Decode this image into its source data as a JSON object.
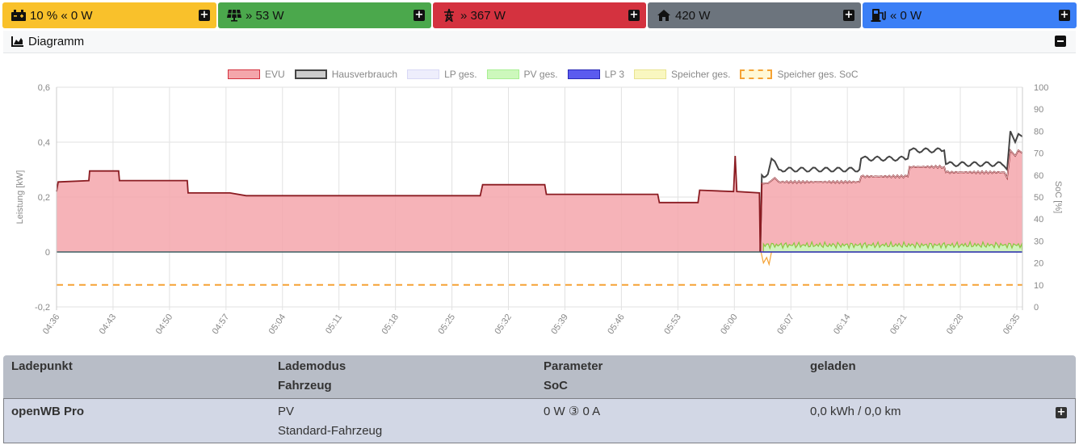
{
  "tiles": [
    {
      "label": "10 % « 0 W",
      "icon": "car-battery-icon",
      "color": "#f9c12b"
    },
    {
      "label": "» 53 W",
      "icon": "solar-panel-icon",
      "color": "#4ba84c"
    },
    {
      "label": "» 367 W",
      "icon": "power-pylon-icon",
      "color": "#d4323f"
    },
    {
      "label": "420 W",
      "icon": "home-icon",
      "color": "#6c747d"
    },
    {
      "label": "« 0 W",
      "icon": "ev-charger-icon",
      "color": "#3b7ff6"
    }
  ],
  "diagram": {
    "title": "Diagramm"
  },
  "chart_data": {
    "type": "area",
    "legend": [
      {
        "name": "EVU",
        "color": "#f4a6ab"
      },
      {
        "name": "Hausverbrauch",
        "color": "#444444"
      },
      {
        "name": "LP ges.",
        "color": "#e6e6fb"
      },
      {
        "name": "PV ges.",
        "color": "#c4f7b0"
      },
      {
        "name": "LP 3",
        "color": "#3a3ad6"
      },
      {
        "name": "Speicher ges.",
        "color": "#f8f6b8"
      },
      {
        "name": "Speicher ges. SoC",
        "color": "#f5a235"
      }
    ],
    "ylabel_left": "Leistung [kW]",
    "ylabel_right": "SoC [%]",
    "ylim": [
      -0.2,
      0.6
    ],
    "y2lim": [
      0,
      100
    ],
    "yticks_left": [
      "0,6",
      "0,4",
      "0,2",
      "0",
      "-0,2"
    ],
    "yticks_left_values": [
      0.6,
      0.4,
      0.2,
      0,
      -0.2
    ],
    "yticks_right": [
      "100",
      "90",
      "80",
      "70",
      "60",
      "50",
      "40",
      "30",
      "20",
      "10",
      "0"
    ],
    "xticks": [
      "04:36",
      "04:43",
      "04:50",
      "04:57",
      "05:04",
      "05:11",
      "05:18",
      "05:25",
      "05:32",
      "05:39",
      "05:46",
      "05:53",
      "06:00",
      "06:07",
      "06:14",
      "06:21",
      "06:28",
      "06:35"
    ],
    "x_minutes": [
      0,
      7,
      14,
      21,
      28,
      35,
      42,
      49,
      56,
      63,
      70,
      77,
      84,
      91,
      98,
      105,
      112,
      119
    ],
    "x_range": [
      0,
      119.7
    ],
    "evu": [
      [
        0,
        0.22
      ],
      [
        0.2,
        0.255
      ],
      [
        4,
        0.26
      ],
      [
        4.1,
        0.295
      ],
      [
        7.7,
        0.295
      ],
      [
        7.8,
        0.26
      ],
      [
        16.2,
        0.26
      ],
      [
        16.3,
        0.215
      ],
      [
        21.5,
        0.215
      ],
      [
        23.5,
        0.205
      ],
      [
        45,
        0.205
      ],
      [
        52.5,
        0.205
      ],
      [
        52.8,
        0.245
      ],
      [
        60.5,
        0.245
      ],
      [
        60.7,
        0.21
      ],
      [
        74.5,
        0.21
      ],
      [
        74.7,
        0.18
      ],
      [
        79.5,
        0.18
      ],
      [
        79.7,
        0.225
      ],
      [
        83.9,
        0.22
      ],
      [
        84.1,
        0.35
      ],
      [
        84.3,
        0.22
      ],
      [
        87.1,
        0.215
      ],
      [
        87.2,
        0.0
      ],
      [
        87.4,
        0.25
      ],
      [
        88.6,
        0.26
      ],
      [
        89,
        0.27
      ],
      [
        89.5,
        0.255
      ],
      [
        99.5,
        0.255
      ],
      [
        99.7,
        0.275
      ],
      [
        105.5,
        0.275
      ],
      [
        105.7,
        0.31
      ],
      [
        110,
        0.31
      ],
      [
        110.2,
        0.29
      ],
      [
        117.8,
        0.27
      ],
      [
        118.2,
        0.37
      ],
      [
        118.8,
        0.35
      ],
      [
        119.2,
        0.37
      ],
      [
        119.7,
        0.36
      ]
    ],
    "haus": [
      [
        87.2,
        0.0
      ],
      [
        87.4,
        0.28
      ],
      [
        88.6,
        0.34
      ],
      [
        89,
        0.33
      ],
      [
        89.5,
        0.3
      ],
      [
        99.5,
        0.3
      ],
      [
        99.7,
        0.34
      ],
      [
        105.5,
        0.34
      ],
      [
        105.7,
        0.37
      ],
      [
        110,
        0.37
      ],
      [
        110.2,
        0.32
      ],
      [
        117.8,
        0.3
      ],
      [
        118.2,
        0.44
      ],
      [
        118.8,
        0.4
      ],
      [
        119.2,
        0.43
      ],
      [
        119.7,
        0.42
      ]
    ],
    "pv_level": 0.025,
    "pv_start": 87.6,
    "soc_percent": 10
  },
  "table": {
    "headers": [
      {
        "line1": "Ladepunkt",
        "line2": ""
      },
      {
        "line1": "Lademodus",
        "line2": "Fahrzeug"
      },
      {
        "line1": "Parameter",
        "line2": "SoC"
      },
      {
        "line1": "geladen",
        "line2": ""
      }
    ],
    "rows": [
      {
        "name": "openWB Pro",
        "mode": "PV",
        "vehicle": "Standard-Fahrzeug",
        "params": "0 W ③ 0 A",
        "charged": "0,0 kWh / 0,0 km"
      }
    ]
  }
}
